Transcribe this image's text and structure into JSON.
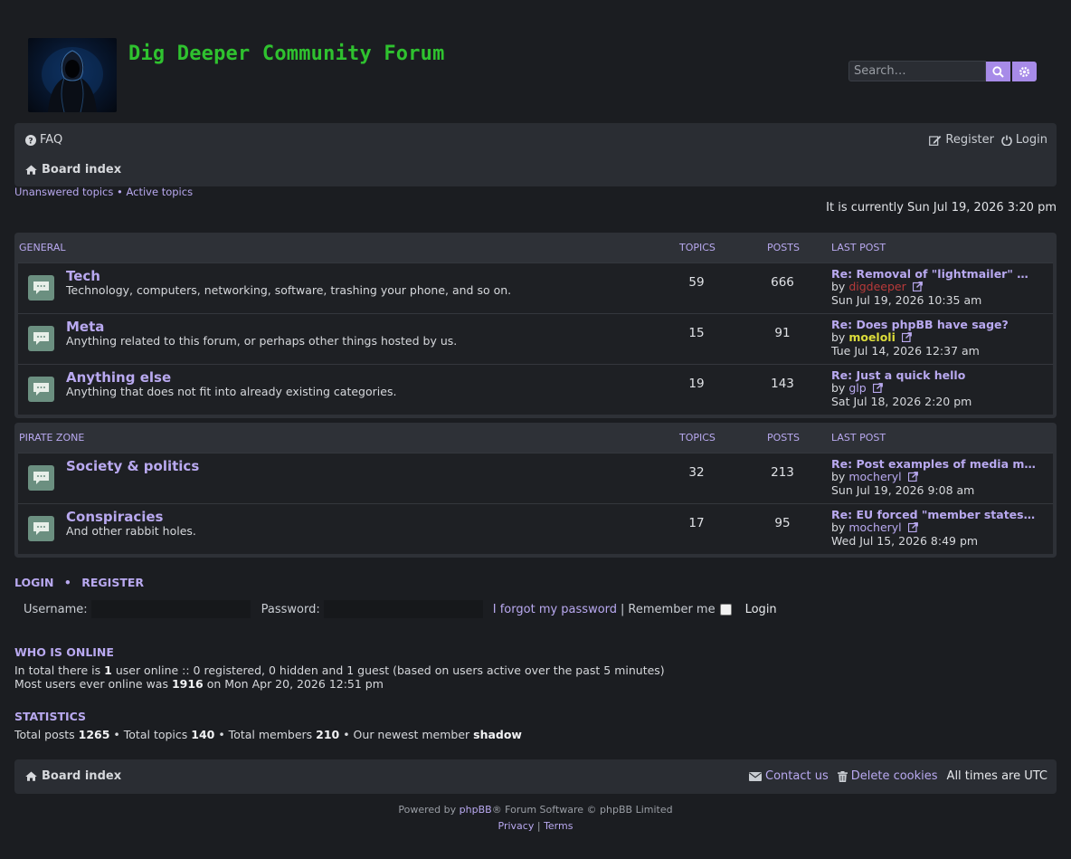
{
  "header": {
    "site_title": "Dig Deeper Community Forum",
    "search_placeholder": "Search…"
  },
  "nav": {
    "faq": "FAQ",
    "register": "Register",
    "login": "Login",
    "board_index": "Board index"
  },
  "quick_links": {
    "unanswered": "Unanswered topics",
    "separator": "•",
    "active": "Active topics"
  },
  "current_time": "It is currently Sun Jul 19, 2026 3:20 pm",
  "columns": {
    "topics": "TOPICS",
    "posts": "POSTS",
    "last_post": "LAST POST"
  },
  "categories": [
    {
      "name": "GENERAL",
      "forums": [
        {
          "name": "Tech",
          "desc": "Technology, computers, networking, software, trashing your phone, and so on.",
          "topics": "59",
          "posts": "666",
          "last_title": "Re: Removal of \"lightmailer\" …",
          "by": "by",
          "author": "digdeeper",
          "date": "Sun Jul 19, 2026 10:35 am"
        },
        {
          "name": "Meta",
          "desc": "Anything related to this forum, or perhaps other things hosted by us.",
          "topics": "15",
          "posts": "91",
          "last_title": "Re: Does phpBB have sage?",
          "by": "by",
          "author": "moeloli",
          "date": "Tue Jul 14, 2026 12:37 am"
        },
        {
          "name": "Anything else",
          "desc": "Anything that does not fit into already existing categories.",
          "topics": "19",
          "posts": "143",
          "last_title": "Re: Just a quick hello",
          "by": "by",
          "author": "glp",
          "date": "Sat Jul 18, 2026 2:20 pm"
        }
      ]
    },
    {
      "name": "PIRATE ZONE",
      "forums": [
        {
          "name": "Society & politics",
          "desc": "",
          "topics": "32",
          "posts": "213",
          "last_title": "Re: Post examples of media ma…",
          "by": "by",
          "author": "mocheryl",
          "date": "Sun Jul 19, 2026 9:08 am"
        },
        {
          "name": "Conspiracies",
          "desc": "And other rabbit holes.",
          "topics": "17",
          "posts": "95",
          "last_title": "Re: EU forced \"member states\"…",
          "by": "by",
          "author": "mocheryl",
          "date": "Wed Jul 15, 2026 8:49 pm"
        }
      ]
    }
  ],
  "login": {
    "heading_login": "LOGIN",
    "heading_sep": "•",
    "heading_register": "REGISTER",
    "username_label": "Username:",
    "password_label": "Password:",
    "forgot": "I forgot my password",
    "pipe": "|",
    "remember": "Remember me",
    "submit": "Login"
  },
  "who_is_online": {
    "heading": "WHO IS ONLINE",
    "line1_pre": "In total there is ",
    "line1_count": "1",
    "line1_post": " user online :: 0 registered, 0 hidden and 1 guest (based on users active over the past 5 minutes)",
    "line2_pre": "Most users ever online was ",
    "line2_count": "1916",
    "line2_post": " on Mon Apr 20, 2026 12:51 pm"
  },
  "statistics": {
    "heading": "STATISTICS",
    "posts_label": "Total posts ",
    "posts": "1265",
    "topics_label": " • Total topics ",
    "topics": "140",
    "members_label": " • Total members ",
    "members": "210",
    "newest_label": " • Our newest member ",
    "newest": "shadow"
  },
  "footer": {
    "board_index": "Board index",
    "contact": "Contact us",
    "delete_cookies": "Delete cookies",
    "timezone": "All times are UTC",
    "powered_pre": "Powered by ",
    "powered_link": "phpBB",
    "powered_post": "® Forum Software © phpBB Limited",
    "privacy": "Privacy",
    "pipe": "|",
    "terms": "Terms"
  },
  "colors": {
    "accent": "#b9a9f0",
    "title_green": "#2fc22f",
    "background": "#1b1d21",
    "panel": "#2a2d33",
    "author_admin": "#b83a3a",
    "author_mod": "#dcdc3a"
  }
}
